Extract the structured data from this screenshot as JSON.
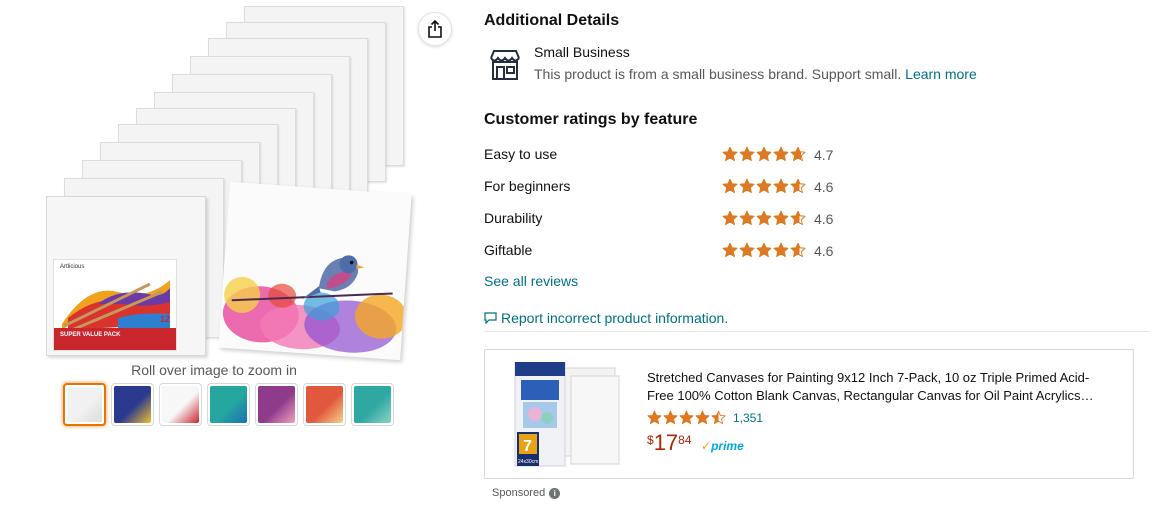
{
  "gallery": {
    "zoom_hint": "Roll over image to zoom in",
    "label_brand": "Artlicious",
    "label_band": "SUPER VALUE PACK",
    "label_count": "12",
    "thumbnails": [
      {
        "name": "thumb-main",
        "colors": [
          "#f1f1f1",
          "#dcdcdc"
        ]
      },
      {
        "name": "thumb-masterpiece",
        "colors": [
          "#2b3a8f",
          "#f2c12e"
        ]
      },
      {
        "name": "thumb-triple-primed",
        "colors": [
          "#f7f7f7",
          "#c9252c"
        ]
      },
      {
        "name": "thumb-paint-types",
        "colors": [
          "#25a7a0",
          "#1f6fb2"
        ]
      },
      {
        "name": "thumb-classes",
        "colors": [
          "#8e3b8c",
          "#f3a1c2"
        ]
      },
      {
        "name": "thumb-high-quality",
        "colors": [
          "#e2583e",
          "#f3d28a"
        ]
      },
      {
        "name": "thumb-artists",
        "colors": [
          "#2fa8a1",
          "#8cd3c5"
        ]
      }
    ]
  },
  "details": {
    "additional_title": "Additional Details",
    "small_business_title": "Small Business",
    "small_business_text": "This product is from a small business brand. Support small.",
    "learn_more": "Learn more",
    "ratings_title": "Customer ratings by feature",
    "ratings": [
      {
        "feature": "Easy to use",
        "value": "4.7",
        "score": 4.7
      },
      {
        "feature": "For beginners",
        "value": "4.6",
        "score": 4.6
      },
      {
        "feature": "Durability",
        "value": "4.6",
        "score": 4.6
      },
      {
        "feature": "Giftable",
        "value": "4.6",
        "score": 4.6
      }
    ],
    "see_all_reviews": "See all reviews",
    "report_link": "Report incorrect product information."
  },
  "sponsored": {
    "title": "Stretched Canvases for Painting 9x12 Inch 7-Pack, 10 oz Triple Primed Acid-Free 100% Cotton Blank Canvas, Rectangular Canvas for Oil Paint Acrylics…",
    "rating": 4.5,
    "review_count": "1,351",
    "price_currency": "$",
    "price_whole": "17",
    "price_fraction": "84",
    "prime_label": "prime",
    "package_count": "7",
    "package_size": "24x30cm",
    "label": "Sponsored"
  },
  "colors": {
    "star": "#de7921",
    "link": "#007185",
    "price": "#b12704",
    "selected_thumb": "#e77600"
  }
}
